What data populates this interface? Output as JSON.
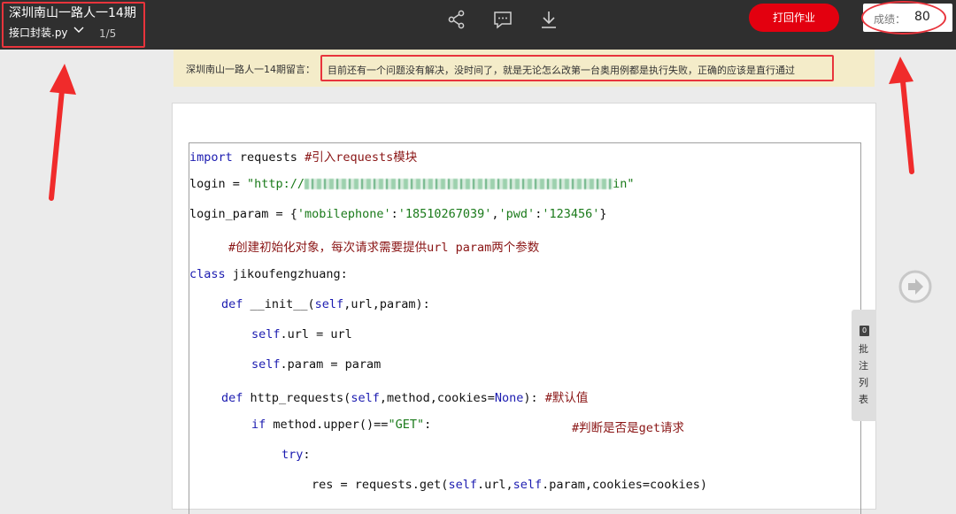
{
  "header": {
    "title": "深圳南山一路人一14期",
    "file_name": "接口封装.py",
    "page": "1/5",
    "submit_label": "打回作业",
    "score_label": "成绩：",
    "score_value": "80",
    "icons": [
      "share-icon",
      "comment-icon",
      "download-icon",
      "chevron-down-icon"
    ]
  },
  "banner": {
    "label": "深圳南山一路人一14期留言：",
    "message": "目前还有一个问题没有解决，没时间了，就是无论怎么改第一台奥用例都是执行失败，正确的应该是直行通过"
  },
  "code": {
    "l1_kw": "import",
    "l1_txt": " requests ",
    "l1_cm": "#引入requests模块",
    "l2_txt": "login = ",
    "l2_str_a": "\"http://",
    "l2_str_b": "in\"",
    "l3_txt": "login_param = {",
    "l3_s1": "'mobilephone'",
    "l3_c1": ":",
    "l3_s2": "'18510267039'",
    "l3_c2": ",",
    "l3_s3": "'pwd'",
    "l3_c3": ":",
    "l3_s4": "'123456'",
    "l3_end": "}",
    "l4_cm": "#创建初始化对象，每次请求需要提供url param两个参数",
    "l5_kw": "class",
    "l5_txt": " jikoufengzhuang:",
    "l6_kw": "def",
    "l6_txt": " __init__(",
    "l6_self": "self",
    "l6_rest": ",url,param):",
    "l7_self": "self",
    "l7_txt": ".url = url",
    "l8_self": "self",
    "l8_txt": ".param = param",
    "l9_kw": "def",
    "l9_txt": " http_requests(",
    "l9_self": "self",
    "l9_mid": ",method,cookies=",
    "l9_none": "None",
    "l9_end": "): ",
    "l9_cm": "#默认值",
    "l10_kw": "if",
    "l10_txt": " method.upper()==",
    "l10_str": "\"GET\"",
    "l10_colon": ":",
    "l10_cm": "#判断是否是get请求",
    "l11_kw": "try",
    "l11_txt": ":",
    "l12_txt": "res = requests.get(",
    "l12_self1": "self",
    "l12_mid": ".url,",
    "l12_self2": "self",
    "l12_end": ".param,cookies=cookies)"
  },
  "annotations": {
    "count": "0",
    "label_chars": [
      "批",
      "注",
      "列",
      "表"
    ]
  },
  "colors": {
    "accent_red": "#e3000f",
    "topbar": "#2f2f2f",
    "banner": "#f4ecc9",
    "keyword": "#1b1bb0",
    "string": "#1a7a1a",
    "comment": "#8a1515"
  }
}
